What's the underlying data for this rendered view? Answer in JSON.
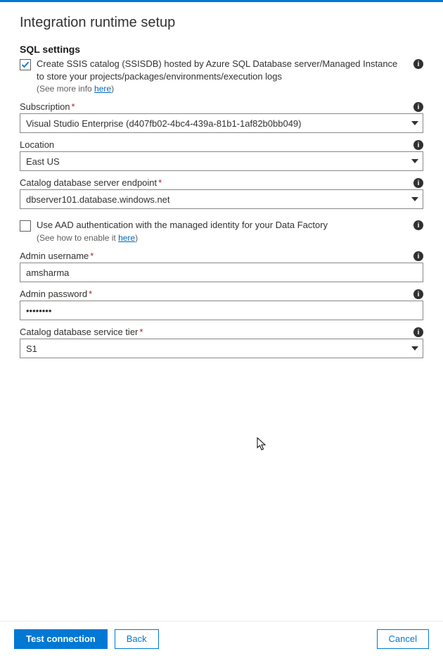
{
  "page": {
    "title": "Integration runtime setup"
  },
  "section": {
    "title": "SQL settings"
  },
  "ssis": {
    "checked": true,
    "text": "Create SSIS catalog (SSISDB) hosted by Azure SQL Database server/Managed Instance to store your projects/packages/environments/execution logs",
    "hint_prefix": "(See more info ",
    "hint_link": "here",
    "hint_suffix": ")"
  },
  "subscription": {
    "label": "Subscription",
    "required": true,
    "value": "Visual Studio Enterprise (d407fb02-4bc4-439a-81b1-1af82b0bb049)"
  },
  "location": {
    "label": "Location",
    "required": false,
    "value": "East US"
  },
  "endpoint": {
    "label": "Catalog database server endpoint",
    "required": true,
    "value": "dbserver101.database.windows.net"
  },
  "aad": {
    "checked": false,
    "text": "Use AAD authentication with the managed identity for your Data Factory",
    "hint_prefix": "(See how to enable it ",
    "hint_link": "here",
    "hint_suffix": ")"
  },
  "admin_user": {
    "label": "Admin username",
    "required": true,
    "value": "amsharma"
  },
  "admin_pass": {
    "label": "Admin password",
    "required": true,
    "value": "••••••••"
  },
  "tier": {
    "label": "Catalog database service tier",
    "required": true,
    "value": "S1"
  },
  "buttons": {
    "test": "Test connection",
    "back": "Back",
    "cancel": "Cancel"
  },
  "glyphs": {
    "info": "i",
    "required": "*"
  }
}
